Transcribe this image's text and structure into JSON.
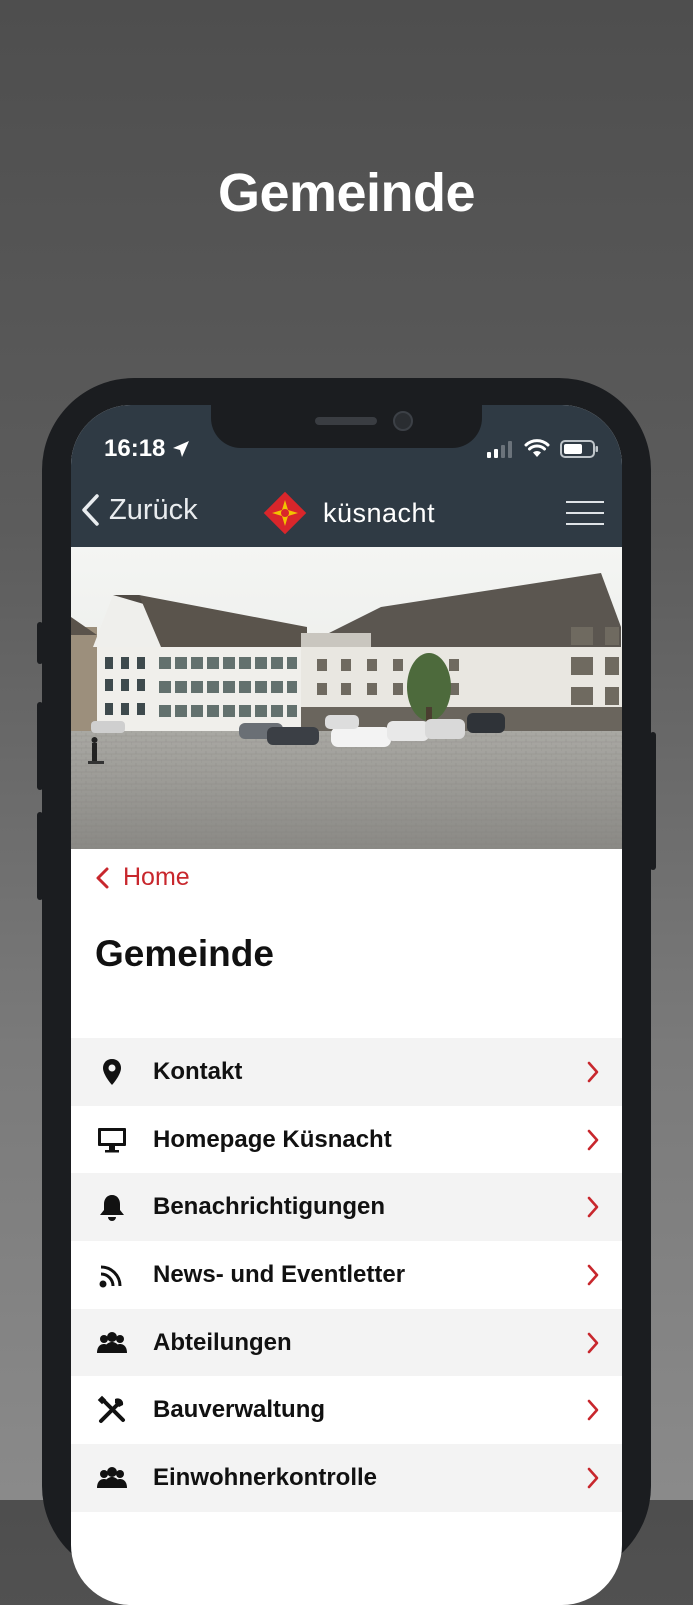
{
  "hero": {
    "title": "Gemeinde"
  },
  "status_bar": {
    "time": "16:18"
  },
  "nav": {
    "back_label": "Zurück",
    "brand_name": "küsnacht"
  },
  "breadcrumb": {
    "label": "Home"
  },
  "page": {
    "title": "Gemeinde"
  },
  "menu": {
    "items": [
      {
        "label": "Kontakt",
        "icon": "location-pin-icon"
      },
      {
        "label": "Homepage Küsnacht",
        "icon": "monitor-icon"
      },
      {
        "label": "Benachrichtigungen",
        "icon": "bell-icon"
      },
      {
        "label": "News- und Eventletter",
        "icon": "rss-icon"
      },
      {
        "label": "Abteilungen",
        "icon": "group-icon"
      },
      {
        "label": "Bauverwaltung",
        "icon": "tools-icon"
      },
      {
        "label": "Einwohnerkontrolle",
        "icon": "group-icon"
      }
    ]
  },
  "colors": {
    "accent": "#c8272d",
    "nav_bar": "#2f3a44",
    "logo_red": "#d9262b",
    "logo_yellow": "#f2c200"
  }
}
